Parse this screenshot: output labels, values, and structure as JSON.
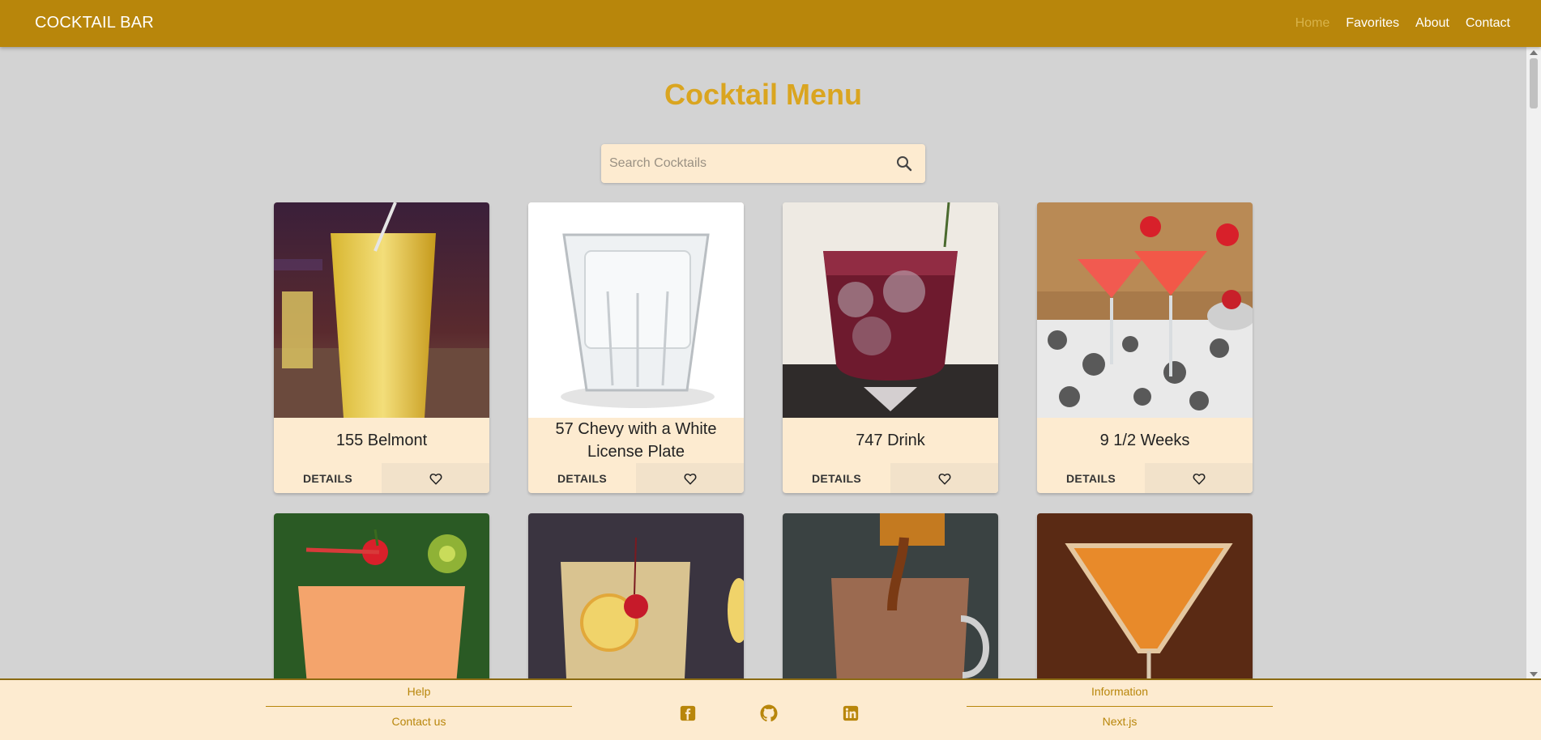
{
  "nav": {
    "brand": "COCKTAIL BAR",
    "links": [
      {
        "label": "Home",
        "active": true
      },
      {
        "label": "Favorites"
      },
      {
        "label": "About"
      },
      {
        "label": "Contact"
      }
    ]
  },
  "main": {
    "title": "Cocktail Menu",
    "search": {
      "placeholder": "Search Cocktails",
      "value": "",
      "icon": "search-icon"
    },
    "cards": [
      {
        "name": "155 Belmont",
        "details_label": "DETAILS",
        "favorite_icon": "heart-outline-icon"
      },
      {
        "name": "57 Chevy with a White License Plate",
        "details_label": "DETAILS",
        "favorite_icon": "heart-outline-icon"
      },
      {
        "name": "747 Drink",
        "details_label": "DETAILS",
        "favorite_icon": "heart-outline-icon"
      },
      {
        "name": "9 1/2 Weeks",
        "details_label": "DETAILS",
        "favorite_icon": "heart-outline-icon"
      },
      {
        "name": "",
        "details_label": "",
        "favorite_icon": ""
      },
      {
        "name": "",
        "details_label": "",
        "favorite_icon": ""
      },
      {
        "name": "",
        "details_label": "",
        "favorite_icon": ""
      },
      {
        "name": "",
        "details_label": "",
        "favorite_icon": ""
      }
    ]
  },
  "footer": {
    "left": [
      "Help",
      "Contact us"
    ],
    "right": [
      "Information",
      "Next.js"
    ],
    "social_icons": [
      "facebook-icon",
      "github-icon",
      "linkedin-icon"
    ]
  },
  "colors": {
    "nav_background": "#b8860b",
    "title": "#daa520",
    "card_background": "#fdebd0",
    "page_background": "#d3d3d3"
  }
}
